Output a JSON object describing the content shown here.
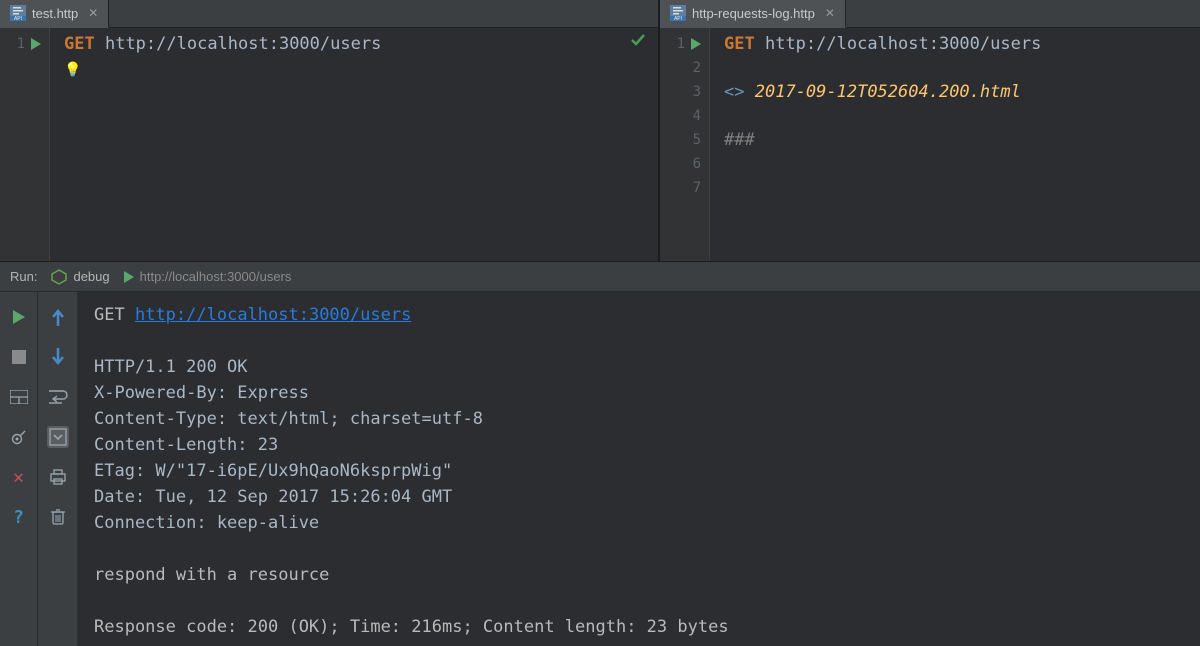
{
  "colors": {
    "method": "#cc7832",
    "url": "#a9b7c6",
    "file": "#ffc66d",
    "link": "#287bde",
    "ok": "#499c54",
    "err": "#c75450"
  },
  "tabs": {
    "left": "test.http",
    "right": "http-requests-log.http"
  },
  "leftEditor": {
    "gutterLines": [
      "1"
    ],
    "method": "GET",
    "url": "http://localhost:3000/users"
  },
  "rightEditor": {
    "gutterLines": [
      "1",
      "2",
      "3",
      "4",
      "5",
      "6",
      "7"
    ],
    "method": "GET",
    "url": "http://localhost:3000/users",
    "responseFile": "2017-09-12T052604.200.html",
    "separator": "###"
  },
  "runBar": {
    "label": "Run:",
    "debug": "debug",
    "httpLabel": "http://localhost:3000/users"
  },
  "console": {
    "method": "GET",
    "url": "http://localhost:3000/users",
    "headers": [
      "HTTP/1.1 200 OK",
      "X-Powered-By: Express",
      "Content-Type: text/html; charset=utf-8",
      "Content-Length: 23",
      "ETag: W/\"17-i6pE/Ux9hQaoN6ksprpWig\"",
      "Date: Tue, 12 Sep 2017 15:26:04 GMT",
      "Connection: keep-alive"
    ],
    "body": "respond with a resource",
    "summary": "Response code: 200 (OK); Time: 216ms; Content length: 23 bytes"
  }
}
